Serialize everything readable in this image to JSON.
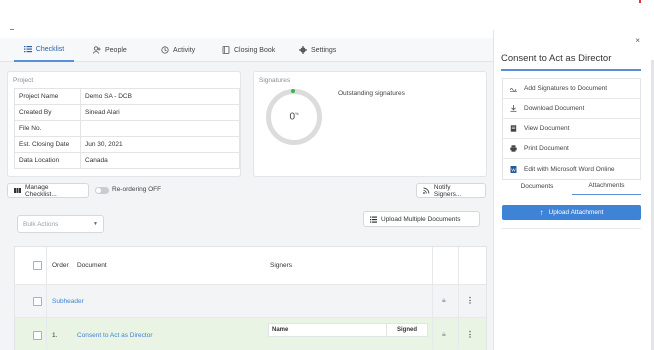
{
  "tabs": [
    {
      "label": "Checklist",
      "icon": "list-icon",
      "active": true
    },
    {
      "label": "People",
      "icon": "people-icon"
    },
    {
      "label": "Activity",
      "icon": "history-icon"
    },
    {
      "label": "Closing Book",
      "icon": "book-icon"
    },
    {
      "label": "Settings",
      "icon": "gear-icon"
    }
  ],
  "project": {
    "title": "Project",
    "rows": [
      {
        "key": "Project Name",
        "value": "Demo SA - DCB"
      },
      {
        "key": "Created By",
        "value": "Sinead Alari"
      },
      {
        "key": "File No.",
        "value": ""
      },
      {
        "key": "Est. Closing Date",
        "value": "Jun 30, 2021"
      },
      {
        "key": "Data Location",
        "value": "Canada"
      }
    ]
  },
  "signatures": {
    "title": "Signatures",
    "count": "0",
    "unit": "%",
    "outstanding_label": "Outstanding signatures"
  },
  "toolbar": {
    "manage_checklist": "Manage Checklist...",
    "reordering": "Re-ordering OFF",
    "notify_signers": "Notify Signers...",
    "bulk_actions_placeholder": "Bulk Actions",
    "upload_multiple": "Upload Multiple Documents"
  },
  "table": {
    "headers": {
      "order": "Order",
      "document": "Document",
      "signers": "Signers"
    },
    "subheader": "Subheader",
    "row1": {
      "order": "1.",
      "document": "Consent to Act as Director",
      "signer_name_header": "Name",
      "signer_signed_header": "Signed"
    }
  },
  "panel": {
    "title": "Consent to Act as Director",
    "close": "×",
    "actions": [
      {
        "label": "Add Signatures to Document",
        "icon": "signature-icon"
      },
      {
        "label": "Download Document",
        "icon": "download-icon"
      },
      {
        "label": "View Document",
        "icon": "document-icon"
      },
      {
        "label": "Print Document",
        "icon": "printer-icon"
      },
      {
        "label": "Edit with Microsoft Word Online",
        "icon": "word-icon"
      }
    ],
    "tabs": [
      {
        "label": "Documents"
      },
      {
        "label": "Attachments",
        "active": true
      }
    ],
    "upload_attachment": "Upload Attachment"
  },
  "colors": {
    "accent": "#3f83d6",
    "active_tab": "#5a8fd6",
    "highlight_row": "#eaf4e4",
    "green": "#38b54a"
  }
}
